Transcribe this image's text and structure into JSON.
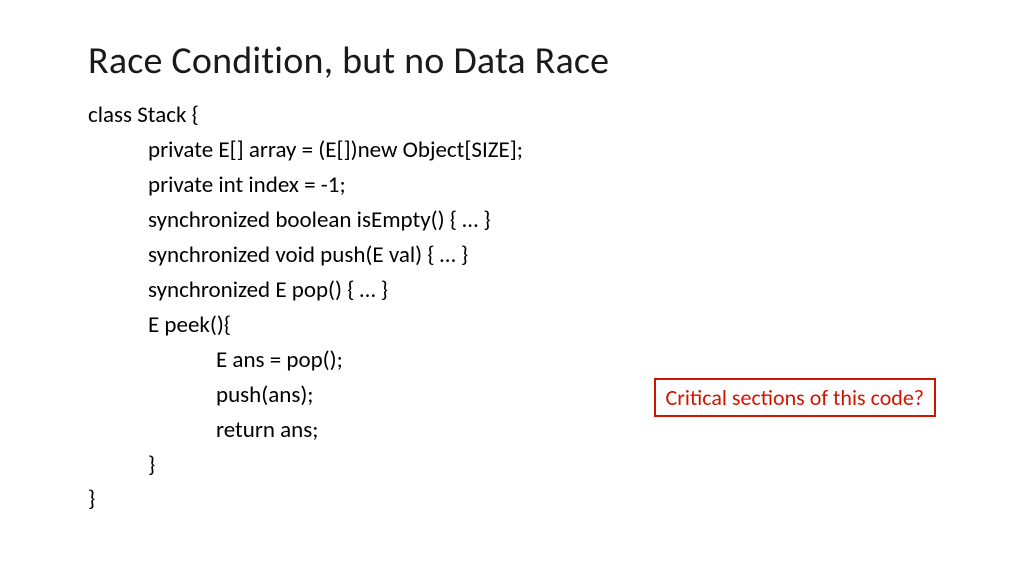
{
  "title": "Race Condition, but no Data Race",
  "code": {
    "l0": "class Stack {",
    "l1": "private E[] array = (E[])new Object[SIZE];",
    "l2": "private int index = -1;",
    "l3": "synchronized boolean isEmpty() { … }",
    "l4": "synchronized void push(E val) { … }",
    "l5": "synchronized E pop() { … }",
    "l6": "E peek(){",
    "l7": "E ans = pop();",
    "l8": "push(ans);",
    "l9": "return ans;",
    "l10": "}",
    "l11": "}"
  },
  "callout": "Critical sections of this code?"
}
